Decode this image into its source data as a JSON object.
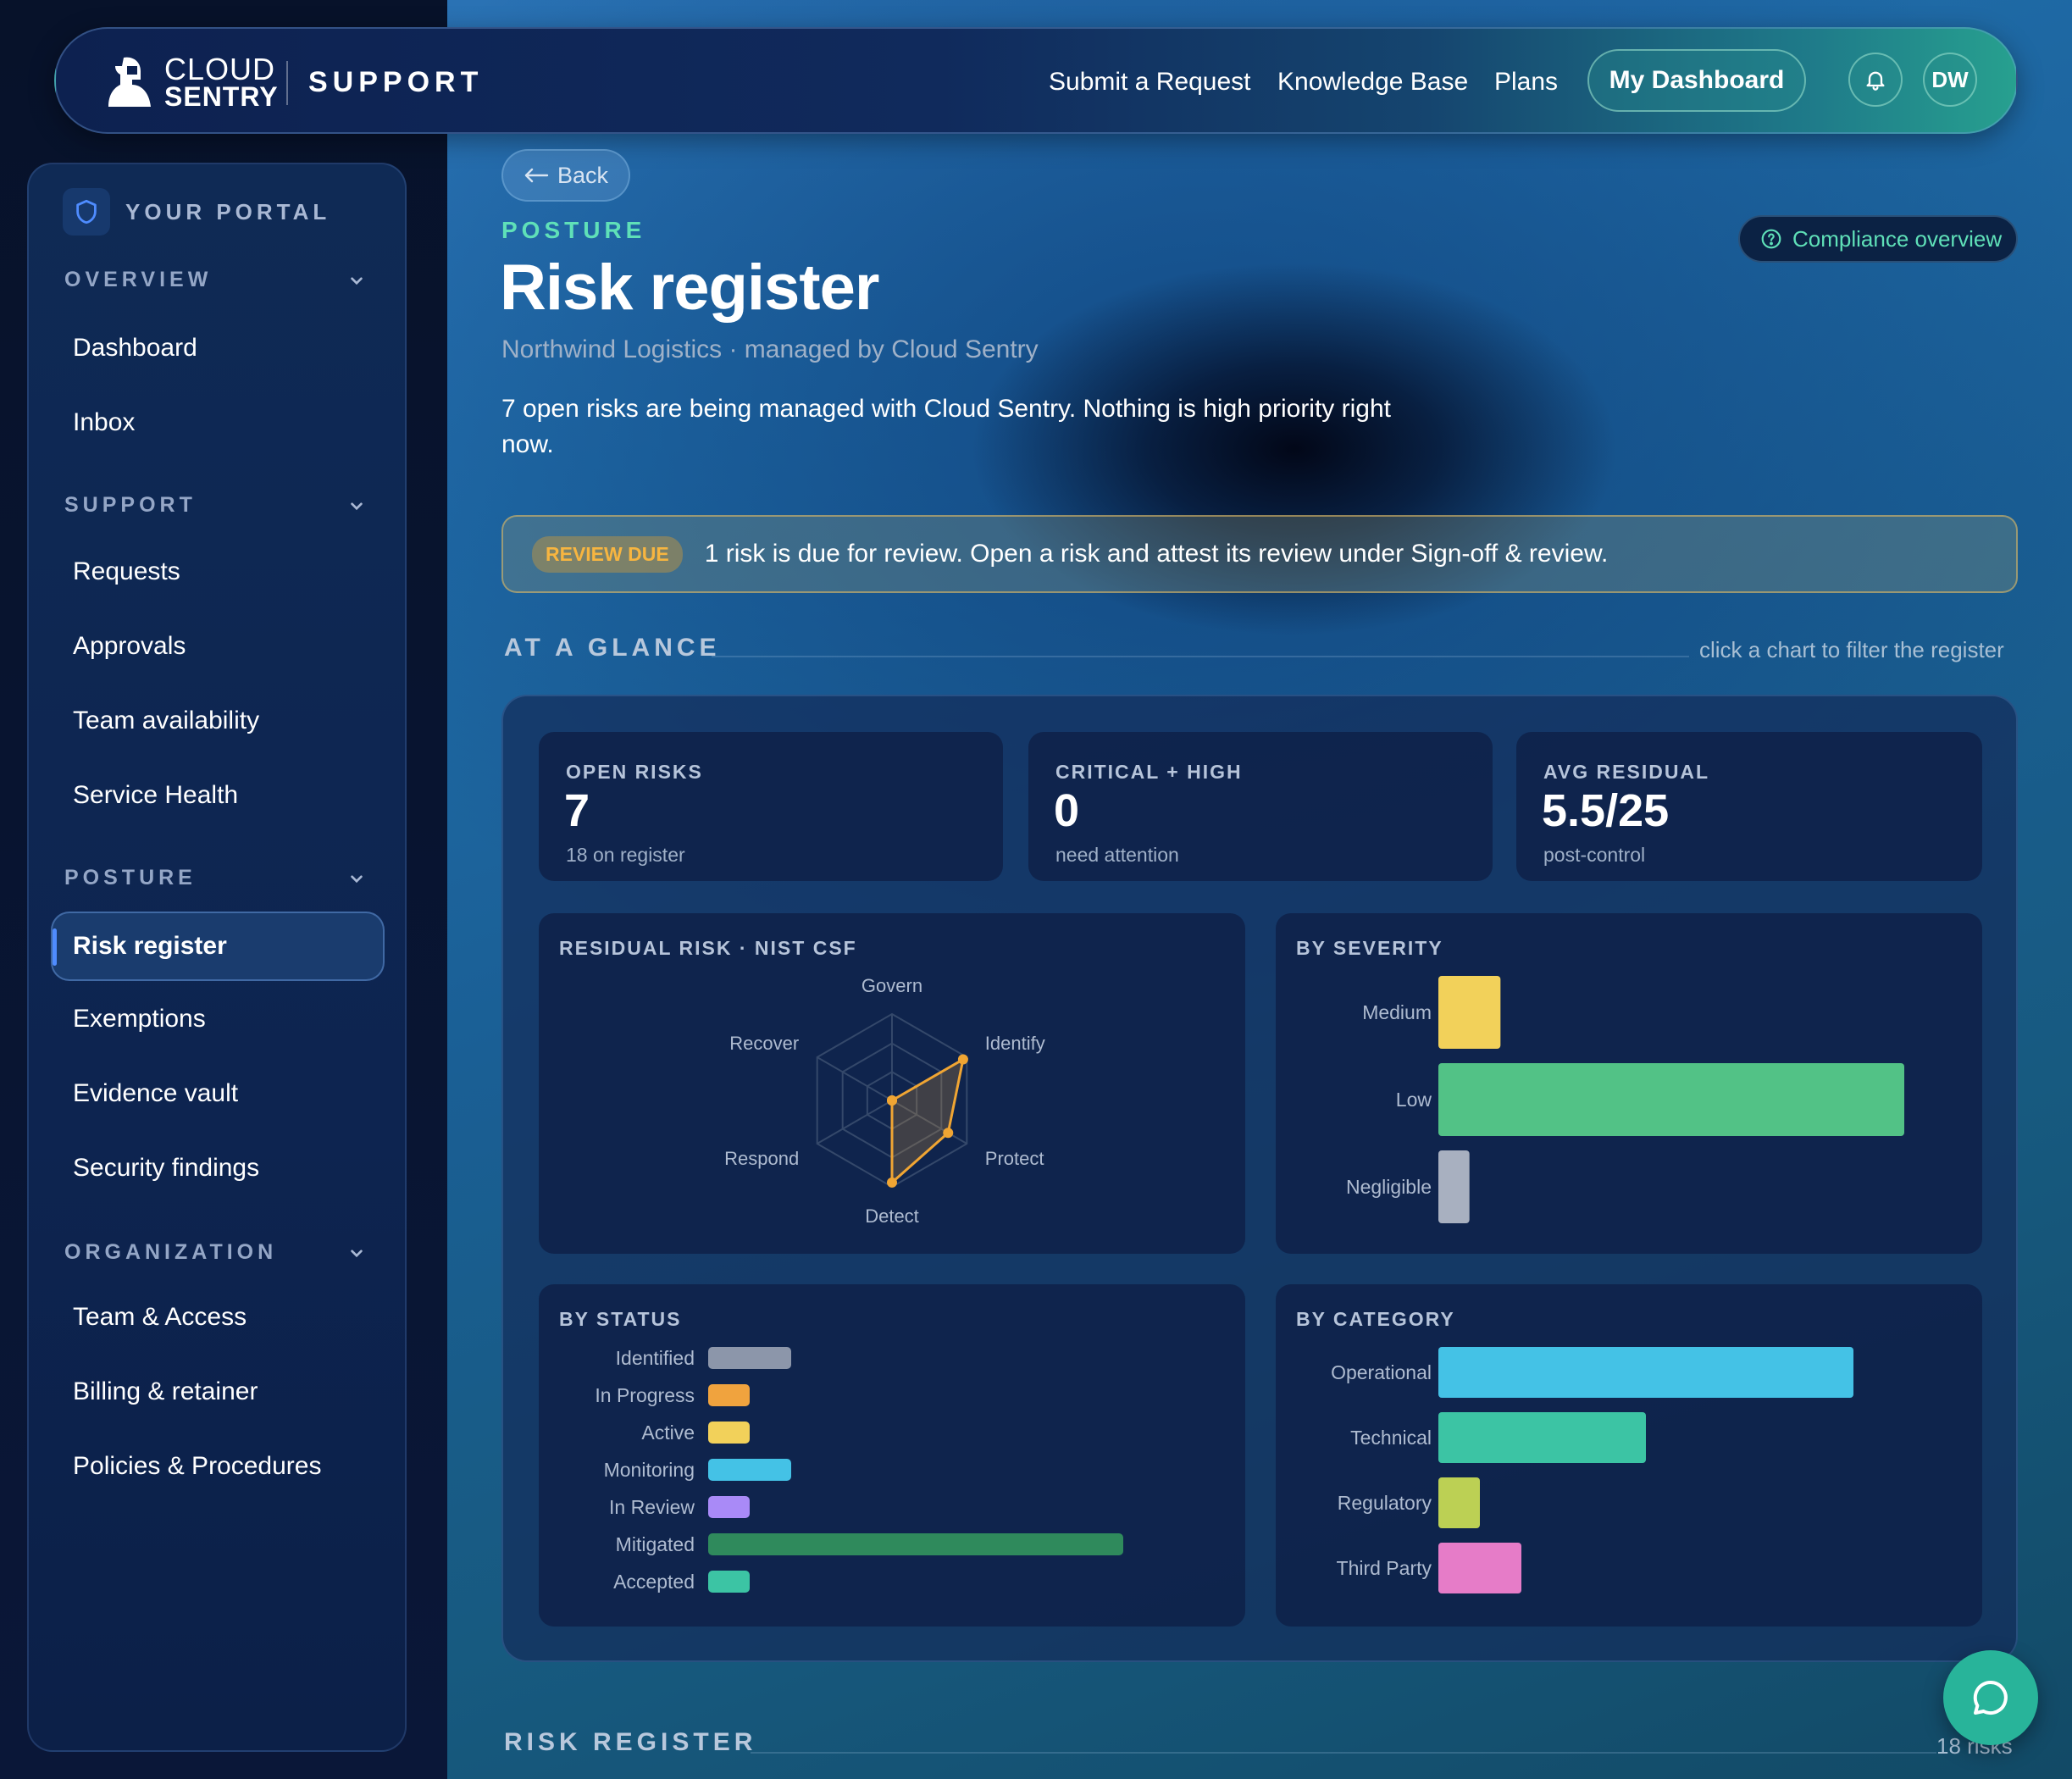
{
  "brand": {
    "line1": "CLOUD",
    "line2": "SENTRY",
    "product": "SUPPORT"
  },
  "topnav": {
    "links": [
      "Submit a Request",
      "Knowledge Base",
      "Plans"
    ],
    "dashboard": "My Dashboard",
    "avatar": "DW"
  },
  "sidebar": {
    "portal": "YOUR PORTAL",
    "sections": [
      {
        "title": "OVERVIEW",
        "items": [
          "Dashboard",
          "Inbox"
        ]
      },
      {
        "title": "SUPPORT",
        "items": [
          "Requests",
          "Approvals",
          "Team availability",
          "Service Health"
        ]
      },
      {
        "title": "POSTURE",
        "items": [
          "Risk register",
          "Exemptions",
          "Evidence vault",
          "Security findings"
        ]
      },
      {
        "title": "ORGANIZATION",
        "items": [
          "Team & Access",
          "Billing & retainer",
          "Policies & Procedures"
        ]
      }
    ],
    "active": "Risk register"
  },
  "page": {
    "back": "Back",
    "eyebrow": "POSTURE",
    "title": "Risk register",
    "subtitle": "Northwind Logistics · managed by Cloud Sentry",
    "summary": "7 open risks are being managed with Cloud Sentry. Nothing is high priority right now.",
    "compliance": "Compliance overview"
  },
  "alert": {
    "badge": "REVIEW DUE",
    "message": "1 risk is due for review. Open a risk and attest its review under Sign-off & review."
  },
  "glance": {
    "title": "AT A GLANCE",
    "hint": "click a chart to filter the register",
    "kpis": [
      {
        "label": "OPEN RISKS",
        "value": "7",
        "sub": "18 on register"
      },
      {
        "label": "CRITICAL + HIGH",
        "value": "0",
        "sub": "need attention"
      },
      {
        "label": "AVG RESIDUAL",
        "value": "5.5/25",
        "sub": "post-control"
      }
    ]
  },
  "register": {
    "title": "RISK REGISTER",
    "count": "18 risks"
  },
  "chart_data": [
    {
      "type": "radar",
      "title": "RESIDUAL RISK · NIST CSF",
      "axes": [
        "Govern",
        "Identify",
        "Protect",
        "Detect",
        "Respond",
        "Recover"
      ],
      "values": [
        0,
        0.95,
        0.75,
        0.95,
        0,
        0
      ],
      "color": "#f0a533"
    },
    {
      "type": "bar",
      "orientation": "horizontal",
      "title": "BY SEVERITY",
      "categories": [
        "Medium",
        "Low",
        "Negligible"
      ],
      "values": [
        2,
        15,
        1
      ],
      "colors": [
        "#f2d15a",
        "#52c286",
        "#a8b0c0"
      ]
    },
    {
      "type": "bar",
      "orientation": "horizontal",
      "title": "BY STATUS",
      "categories": [
        "Identified",
        "In Progress",
        "Active",
        "Monitoring",
        "In Review",
        "Mitigated",
        "Accepted"
      ],
      "values": [
        2,
        1,
        1,
        2,
        1,
        10,
        1
      ],
      "colors": [
        "#8c96aa",
        "#f0a33e",
        "#f2d15a",
        "#44c2e6",
        "#a98af7",
        "#2f8a5c",
        "#3cc4a4"
      ]
    },
    {
      "type": "bar",
      "orientation": "horizontal",
      "title": "BY CATEGORY",
      "categories": [
        "Operational",
        "Technical",
        "Regulatory",
        "Third Party"
      ],
      "values": [
        10,
        5,
        1,
        2
      ],
      "colors": [
        "#44c2e6",
        "#3cc4a4",
        "#bcd054",
        "#e67cc8"
      ]
    }
  ]
}
